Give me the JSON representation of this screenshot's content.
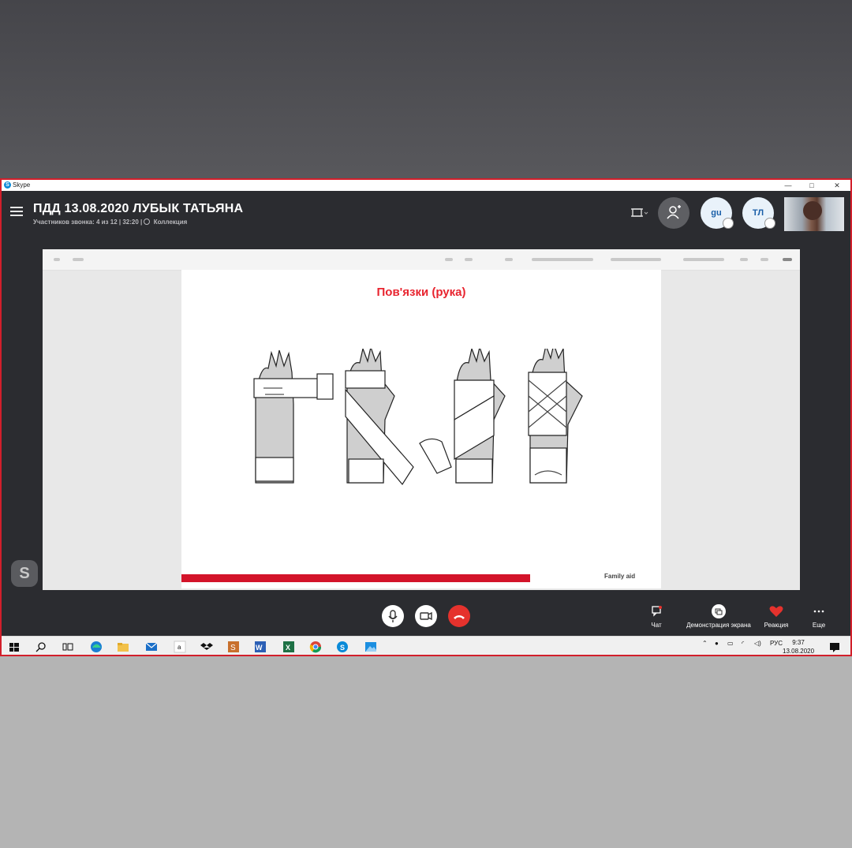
{
  "window": {
    "app_name": "Skype",
    "controls": [
      "—",
      "□",
      "✕"
    ]
  },
  "call": {
    "title": "ПДД 13.08.2020 ЛУБЫК ТАТЬЯНА",
    "subtitle": "Участников звонка: 4 из 12 | 32:20 | ",
    "collection": "Коллекция"
  },
  "participants": [
    {
      "initials": "gu",
      "muted": true
    },
    {
      "initials": "ТЛ",
      "muted": true
    }
  ],
  "slide": {
    "title": "Пов'язки (рука)",
    "brand": "Family aid"
  },
  "actions": {
    "chat": "Чат",
    "share_screen": "Демонстрация экрана",
    "reaction": "Реакция",
    "more": "Еще"
  },
  "taskbar": {
    "language": "РУС",
    "time": "9:37",
    "date": "13.08.2020",
    "icons": [
      "windows-start",
      "search",
      "task-view",
      "edge",
      "file-explorer",
      "mail",
      "amazon",
      "dropbox",
      "sublime",
      "word",
      "excel",
      "chrome",
      "skype",
      "photos"
    ]
  },
  "colors": {
    "frame": "#d21f2b",
    "header_bg": "#2b2c30",
    "end_call": "#e5322d",
    "slide_title": "#e8242f",
    "slide_bar": "#d3142a",
    "skype_blue": "#0a8ad8"
  }
}
